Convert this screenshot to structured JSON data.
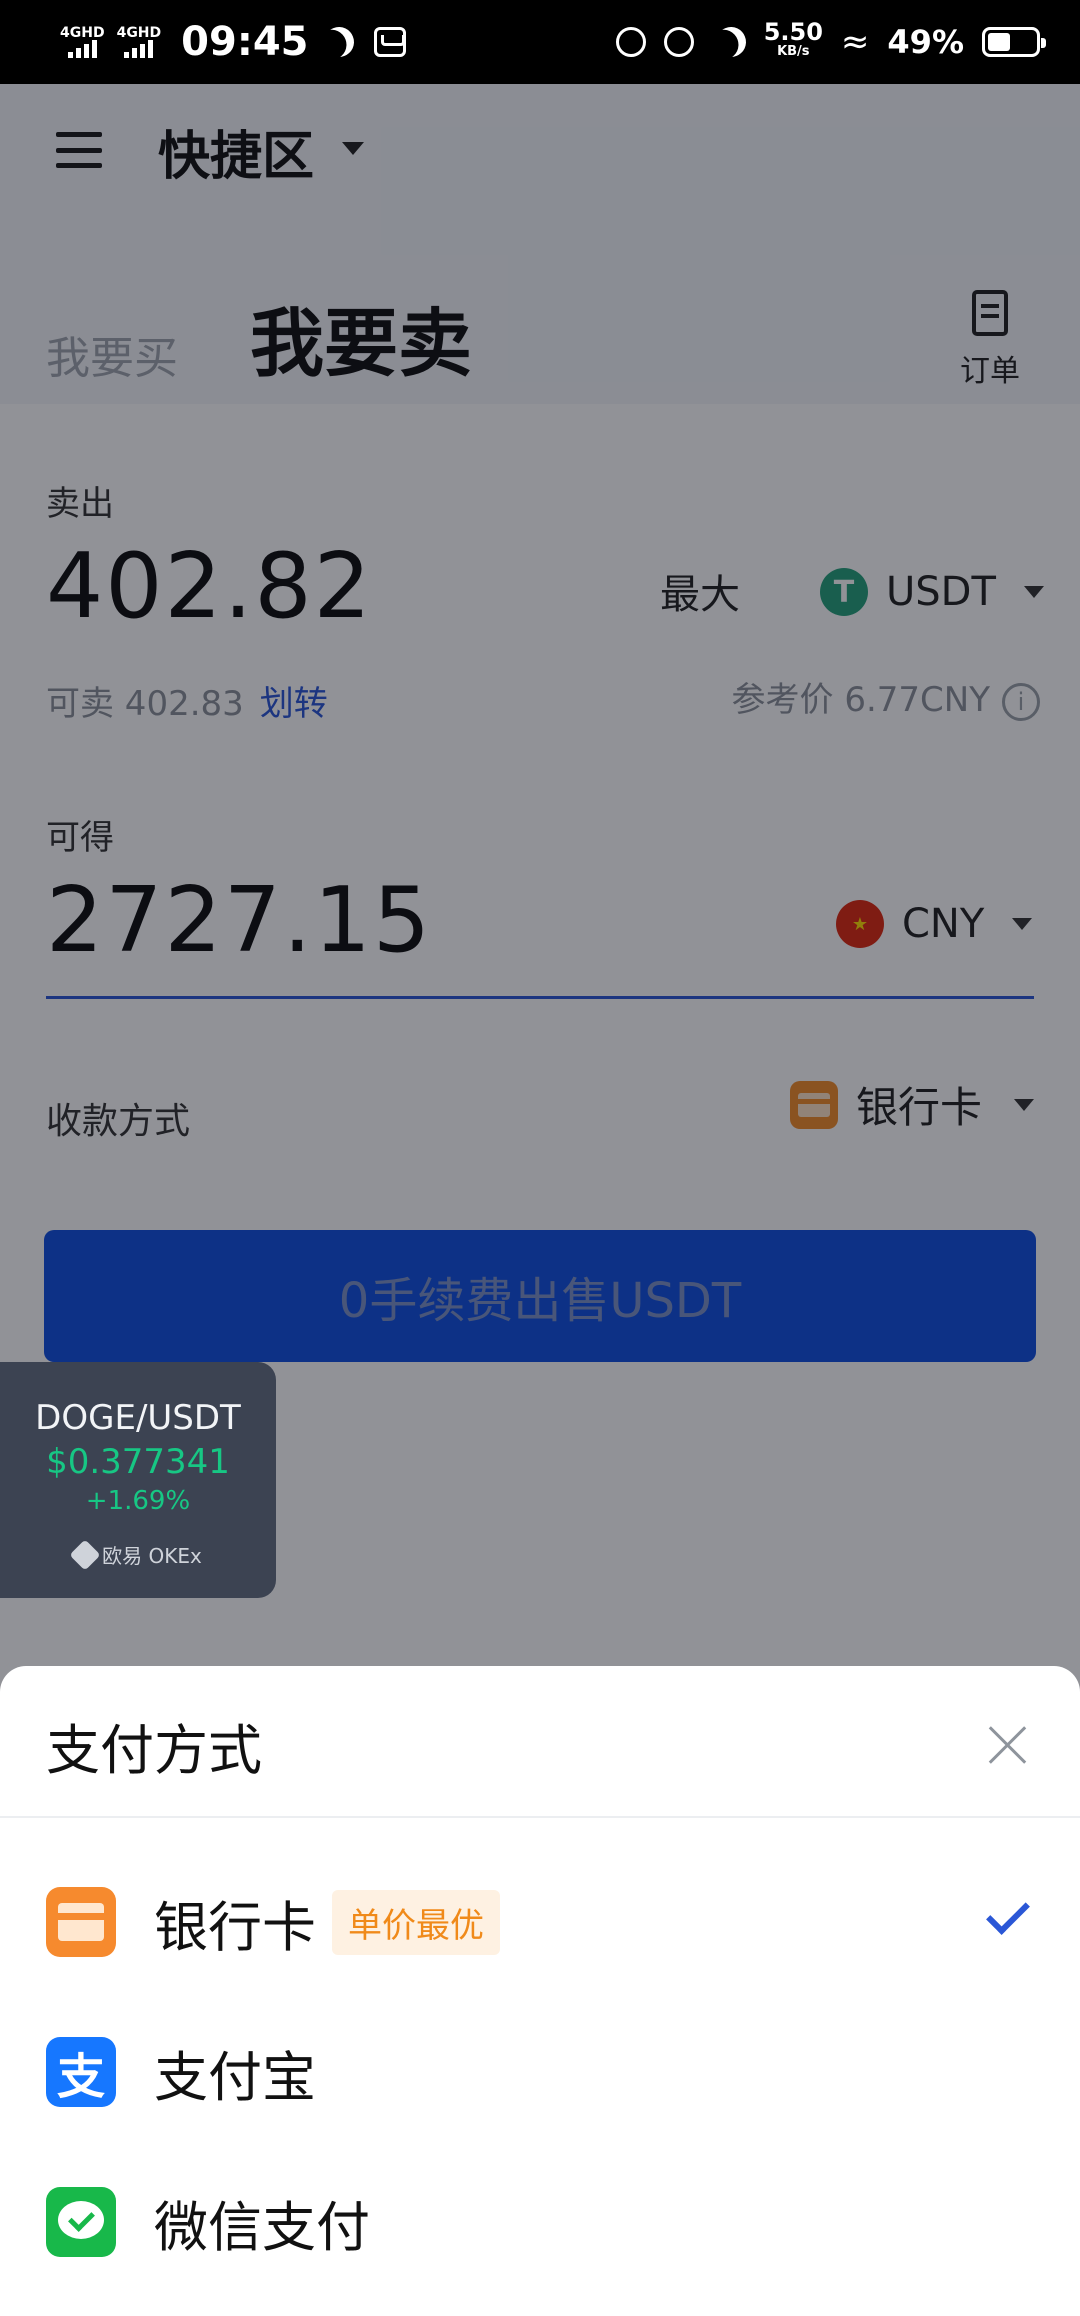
{
  "status_bar": {
    "network_1": "4GHD",
    "network_2": "4GHD",
    "time": "09:45",
    "speed_value": "5.50",
    "speed_unit": "KB/s",
    "battery": "49%"
  },
  "header": {
    "area_title": "快捷区",
    "tab_buy": "我要买",
    "tab_sell": "我要卖",
    "orders_label": "订单"
  },
  "sell": {
    "label": "卖出",
    "amount": "402.82",
    "max_label": "最大",
    "currency": "USDT",
    "available_label": "可卖 402.83",
    "transfer_link": "划转",
    "ref_price": "参考价 6.77CNY"
  },
  "receive": {
    "label": "可得",
    "amount": "2727.15",
    "currency": "CNY"
  },
  "payment": {
    "label": "收款方式",
    "selected": "银行卡"
  },
  "submit_label": "0手续费出售USDT",
  "ticker": {
    "pair": "DOGE/USDT",
    "price": "$0.377341",
    "change": "+1.69%",
    "brand": "欧易 OKEx"
  },
  "sheet": {
    "title": "支付方式",
    "options": [
      {
        "label": "银行卡",
        "badge": "单价最优",
        "icon": "bank-card-icon",
        "selected": true
      },
      {
        "label": "支付宝",
        "icon": "alipay-icon",
        "icon_glyph": "支",
        "selected": false
      },
      {
        "label": "微信支付",
        "icon": "wechat-pay-icon",
        "selected": false
      }
    ]
  },
  "colors": {
    "accent": "#2b57d6",
    "button": "#0f4fe0",
    "usdt": "#26a17b",
    "cny": "#de2910",
    "bank": "#f68a2e",
    "alipay": "#1677ff",
    "wechat": "#18b84a",
    "up": "#17c784"
  }
}
